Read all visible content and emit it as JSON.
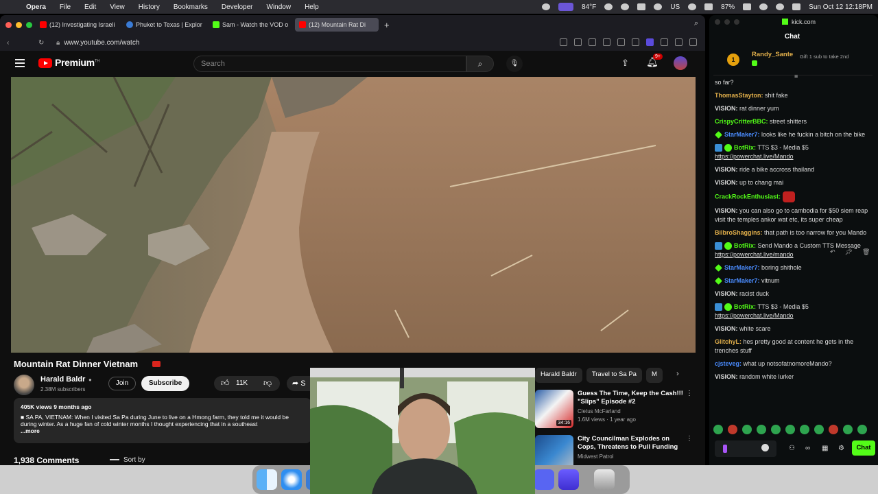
{
  "menubar": {
    "app": "Opera",
    "items": [
      "File",
      "Edit",
      "View",
      "History",
      "Bookmarks",
      "Developer",
      "Window",
      "Help"
    ],
    "weather": "84°F",
    "battery": "87%",
    "input_source": "US",
    "clock": "Sun Oct 12  12:18PM"
  },
  "browser": {
    "tabs": [
      {
        "label": "(12) Investigating Israeli",
        "fav_color": "#ff0000"
      },
      {
        "label": "Phuket to Texas | Explor",
        "fav_color": "#3a7bd5"
      },
      {
        "label": "Sam - Watch the VOD o",
        "fav_color": "#53fc18"
      },
      {
        "label": "(12) Mountain Rat Di",
        "fav_color": "#ff0000"
      }
    ],
    "new_tab": "+",
    "url": "www.youtube.com/watch"
  },
  "youtube": {
    "brand": "Premium",
    "brand_tm": "TH",
    "search_placeholder": "Search",
    "notifications": "9+",
    "video": {
      "title": "Mountain Rat Dinner Vietnam",
      "channel": "Harald Baldr",
      "subscribers": "2.38M subscribers",
      "join": "Join",
      "subscribe": "Subscribe",
      "likes": "11K",
      "share": "S",
      "description_meta": "405K views  9 months ago",
      "description_text": "■ SA PA, VIETNAM: When I visited Sa Pa during June to live on a Hmong farm, they told me it would be during winter. As a huge fan of cold winter months I thought experiencing that in a southeast",
      "more": "...more",
      "comments": "1,938 Comments",
      "sort_by": "Sort by"
    },
    "chips": [
      {
        "label": "Harald Baldr",
        "selected": false
      },
      {
        "label": "Travel to Sa Pa",
        "selected": false
      },
      {
        "label": "M",
        "selected": false
      }
    ],
    "recommendations": [
      {
        "title": "Guess The Time, Keep the Cash!!! \"Slips\" Episode #2",
        "channel": "Cletus McFarland",
        "stats": "1.6M views · 1 year ago",
        "duration": "34:16"
      },
      {
        "title": "City Councilman Explodes on Cops, Threatens to Pull Funding",
        "channel": "Midwest Patrol",
        "stats": "",
        "duration": ""
      }
    ]
  },
  "chat": {
    "domain": "kick.com",
    "title": "Chat",
    "pinned": {
      "rank": "1",
      "user": "Randy_Sante",
      "gift": "Gift 1 sub to take 2nd"
    },
    "messages": [
      {
        "user": "",
        "color": "#ddd",
        "text": "so far?",
        "badge": ""
      },
      {
        "user": "ThomasStayton:",
        "color": "#e3b04b",
        "text": "shit fake",
        "badge": ""
      },
      {
        "user": "VISION:",
        "color": "#dddddd",
        "text": "rat dinner yum",
        "badge": ""
      },
      {
        "user": "CrispyCritterBBC:",
        "color": "#53fc18",
        "text": "street shitters",
        "badge": ""
      },
      {
        "user": "StarMaker7:",
        "color": "#4a8cff",
        "text": "looks like he fuckin a bitch on the bike",
        "badge": "green"
      },
      {
        "user": "BotRix:",
        "color": "#53fc18",
        "text": "TTS $3 - Media $5",
        "link": "https://powerchat.live/Mando",
        "badge": "bot"
      },
      {
        "user": "VISION:",
        "color": "#dddddd",
        "text": "ride a bike accross thailand",
        "badge": ""
      },
      {
        "user": "VISION:",
        "color": "#dddddd",
        "text": "up to chang mai",
        "badge": ""
      },
      {
        "user": "CrackRockEnthusiast:",
        "color": "#53fc18",
        "text": "",
        "badge": "",
        "emote": true
      },
      {
        "user": "VISION:",
        "color": "#dddddd",
        "text": "you can also go to cambodia for $50 siem reap visit the temples ankor wat etc, its super cheap",
        "badge": ""
      },
      {
        "user": "BilbroShaggins:",
        "color": "#e3b04b",
        "text": "that path is too narrow for you Mando",
        "badge": ""
      },
      {
        "user": "BotRix:",
        "color": "#53fc18",
        "text": "Send Mando a Custom TTS Message",
        "link": "https://powerchat.live/mando",
        "badge": "bot"
      },
      {
        "user": "StarMaker7:",
        "color": "#4a8cff",
        "text": "boring shithole",
        "badge": "green"
      },
      {
        "user": "StarMaker7:",
        "color": "#4a8cff",
        "text": "vitnum",
        "badge": "green"
      },
      {
        "user": "VISION:",
        "color": "#dddddd",
        "text": "racist duck",
        "badge": ""
      },
      {
        "user": "BotRix:",
        "color": "#53fc18",
        "text": "TTS $3 - Media $5",
        "link": "https://powerchat.live/Mando",
        "badge": "bot"
      },
      {
        "user": "VISION:",
        "color": "#dddddd",
        "text": "white scare",
        "badge": ""
      },
      {
        "user": "GlitchyL:",
        "color": "#e3b04b",
        "text": "hes pretty good at content he gets in the trenches stuff",
        "badge": ""
      },
      {
        "user": "cjsteveg:",
        "color": "#4a8cff",
        "text": "what up notsofatnomoreMando?",
        "badge": ""
      },
      {
        "user": "VISION:",
        "color": "#dddddd",
        "text": "random white lurker",
        "badge": ""
      }
    ],
    "send": "Chat"
  }
}
